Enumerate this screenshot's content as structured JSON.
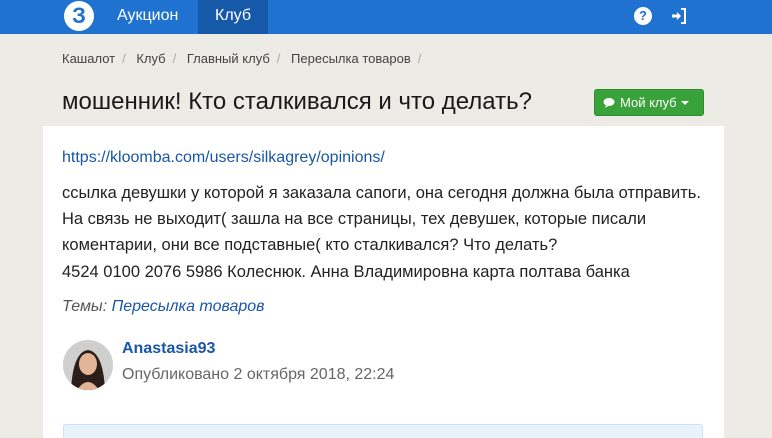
{
  "navbar": {
    "logo_text": "З",
    "links": [
      {
        "label": "Аукцион"
      },
      {
        "label": "Клуб"
      }
    ],
    "icons": [
      "help-icon",
      "login-icon"
    ]
  },
  "breadcrumb": [
    "Кашалот",
    "Клуб",
    "Главный клуб",
    "Пересылка товаров"
  ],
  "title": "мошенник! Кто сталкивался и что делать?",
  "club_button": {
    "label": "Мой клуб"
  },
  "post": {
    "link": "https://kloomba.com/users/silkagrey/opinions/",
    "body": "ссылка девушки у которой я заказала сапоги, она сегодня должна была отправить. На связь не выходит( зашла на все страницы, тех девушек, которые писали коментарии, они все подставные( кто сталкивался? Что делать?",
    "card_line": "4524 0100 2076 5986 Колеснюк. Анна Владимировна карта полтава банка",
    "topics_label": "Темы:",
    "topic": "Пересылка товаров",
    "author": "Anastasia93",
    "published": "Опубликовано 2 октября 2018, 22:24"
  },
  "colors": {
    "nav": "#1f72cf",
    "active_nav": "#1659a8",
    "button": "#3aa23a",
    "link": "#1a56a8"
  }
}
